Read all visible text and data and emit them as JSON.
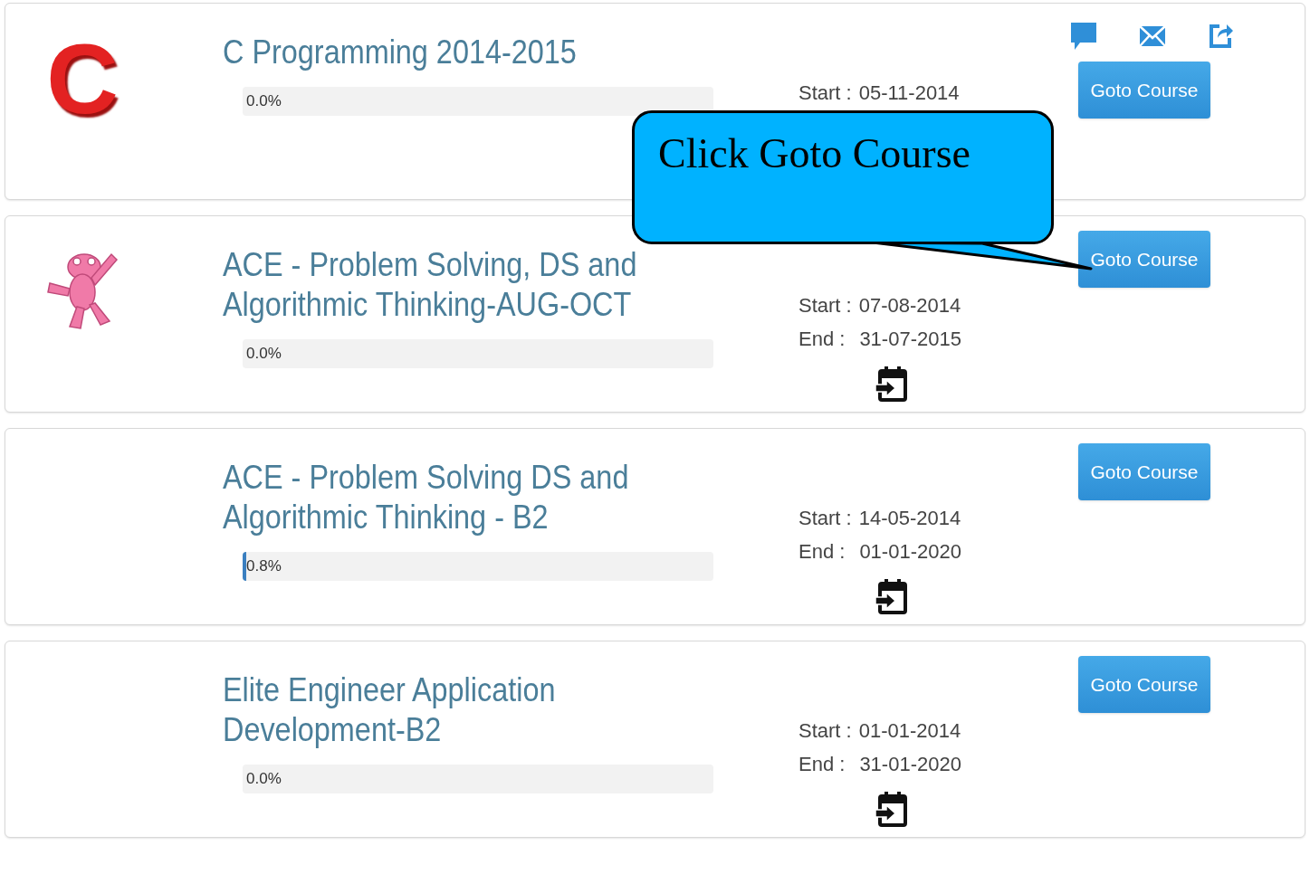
{
  "courses": [
    {
      "title": "C Programming 2014-2015",
      "logo": {
        "kind": "letter",
        "text": "C"
      },
      "progress": {
        "label": "0.0%",
        "level": 0
      },
      "start": {
        "label": "Start :",
        "value": "05-11-2014"
      },
      "actions": true,
      "button": "Goto Course"
    },
    {
      "title": "ACE - Problem Solving, DS and Algorithmic Thinking-AUG-OCT",
      "logo": {
        "kind": "frog"
      },
      "progress": {
        "label": "0.0%",
        "level": 0
      },
      "start": {
        "label": "Start :",
        "value": "07-08-2014"
      },
      "end": {
        "label": "End :",
        "value": "31-07-2015"
      },
      "actions": false,
      "button": "Goto Course"
    },
    {
      "title": "ACE - Problem Solving DS and Algorithmic Thinking - B2",
      "logo": {
        "kind": "none"
      },
      "progress": {
        "label": "0.8%",
        "level": 0.008
      },
      "start": {
        "label": "Start :",
        "value": "14-05-2014"
      },
      "end": {
        "label": "End :",
        "value": "01-01-2020"
      },
      "actions": false,
      "button": "Goto Course"
    },
    {
      "title": "Elite Engineer Application Development-B2",
      "logo": {
        "kind": "none"
      },
      "progress": {
        "label": "0.0%",
        "level": 0
      },
      "start": {
        "label": "Start :",
        "value": "01-01-2014"
      },
      "end": {
        "label": "End :",
        "value": "31-01-2020"
      },
      "actions": false,
      "button": "Goto Course"
    }
  ],
  "callout": {
    "text": "Click Goto Course"
  }
}
